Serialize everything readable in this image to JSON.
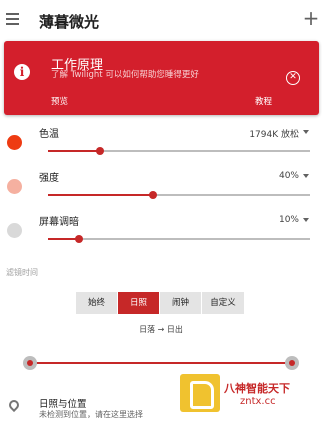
{
  "appbar": {
    "title": "薄暮微光",
    "menu_icon": "hamburger-menu-icon",
    "add_icon": "plus-icon",
    "add_glyph": "+"
  },
  "banner": {
    "title": "工作原理",
    "subtitle": "了解 Twilight 可以如何帮助您睡得更好",
    "preview": "预览",
    "tutorial": "教程",
    "info_glyph": "i",
    "close_glyph": "✕",
    "color": "#d31f2c"
  },
  "settings": [
    {
      "label": "色温",
      "value": "1794K 放松",
      "level": 0.2,
      "color": "#ee3b12"
    },
    {
      "label": "强度",
      "value": "40%",
      "level": 0.4,
      "color": "#f5b0a0"
    },
    {
      "label": "屏幕调暗",
      "value": "10%",
      "level": 0.12,
      "color": "#d9d9d9"
    }
  ],
  "filter_time": {
    "label": "滤镜时间",
    "options": [
      "始终",
      "日照",
      "闹钟",
      "自定义"
    ],
    "selected": "日照",
    "range_text": "日落 → 日出"
  },
  "location": {
    "title": "日照与位置",
    "subtitle": "未检测到位置，请在这里选择"
  },
  "watermark": {
    "title": "八神智能天下",
    "site": "zntx.cc"
  },
  "colors": {
    "accent": "#c62828",
    "track": "#bdbdbd"
  }
}
